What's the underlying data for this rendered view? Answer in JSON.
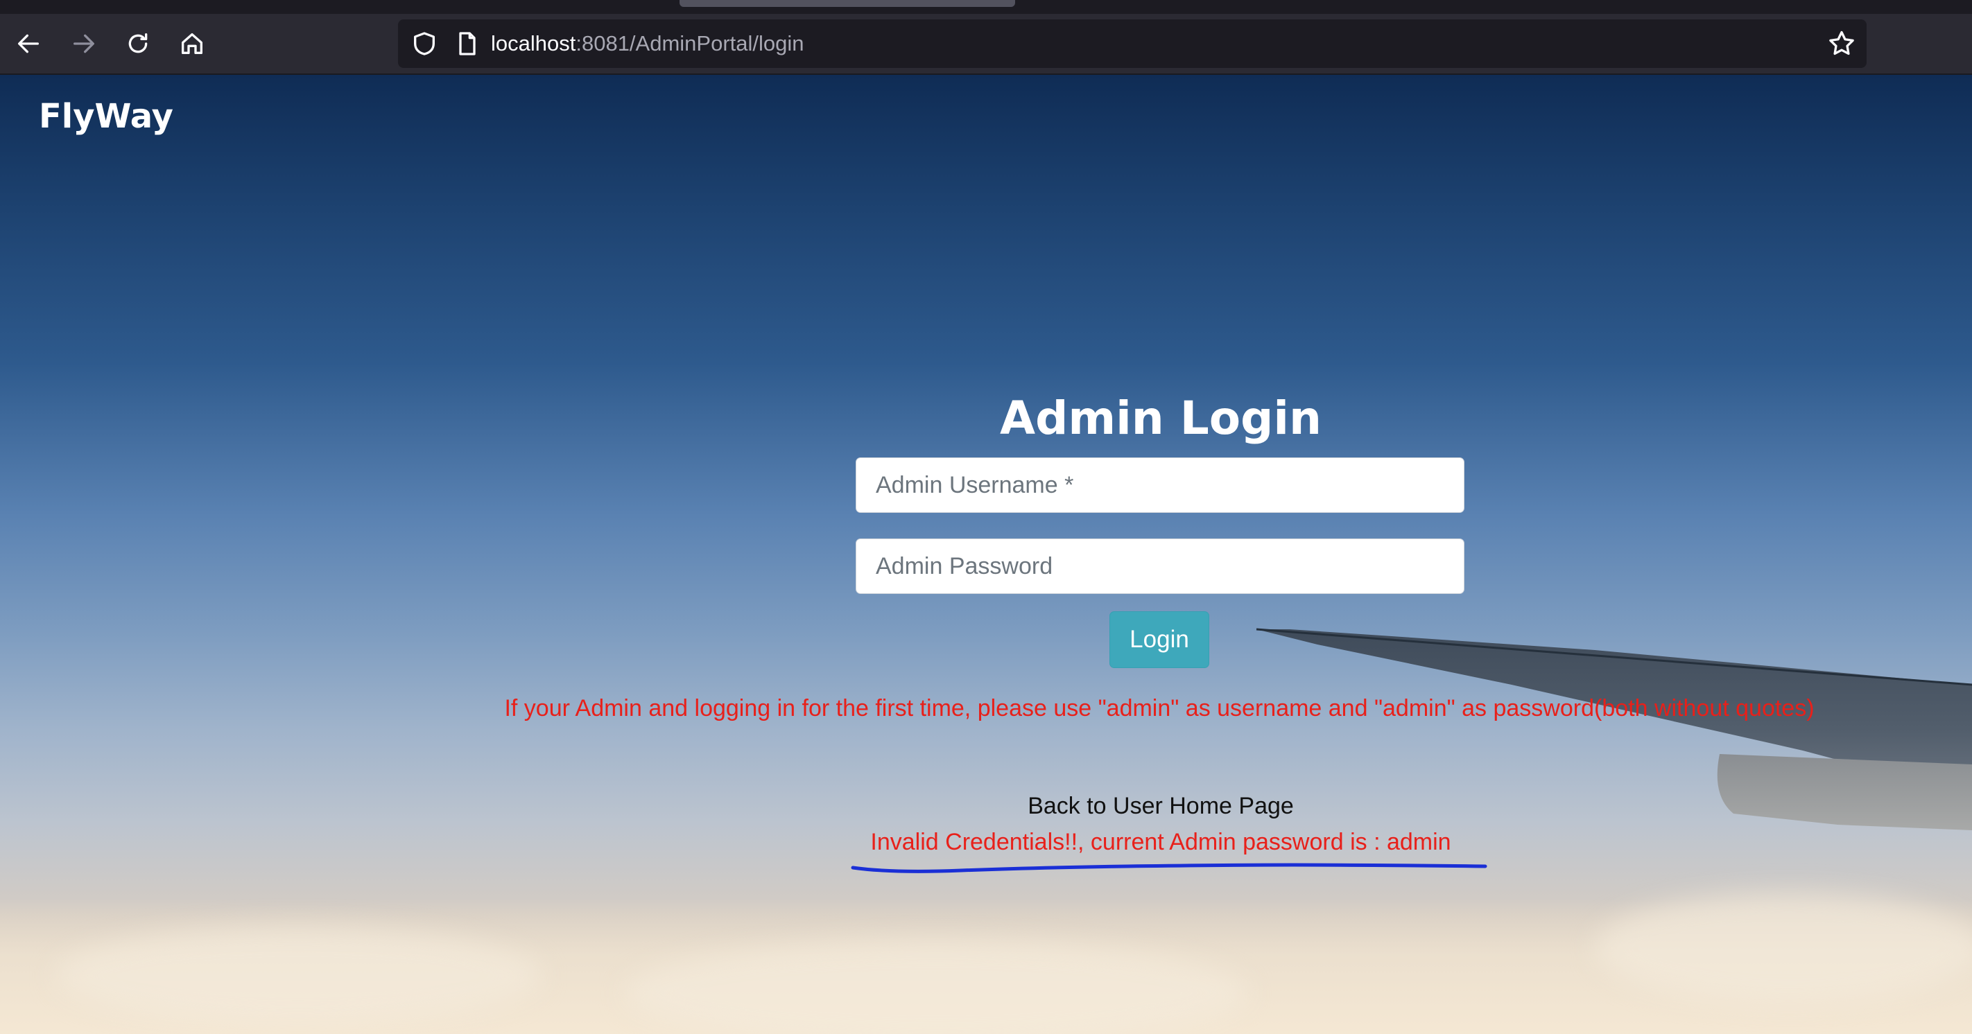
{
  "browser": {
    "url_host": "localhost",
    "url_path": ":8081/AdminPortal/login",
    "icons": {
      "back": "back-arrow-icon",
      "forward": "forward-arrow-icon",
      "reload": "reload-icon",
      "home": "home-icon",
      "shield": "shield-icon",
      "page": "page-icon",
      "bookmark": "star-icon"
    }
  },
  "page": {
    "brand": "FlyWay",
    "title": "Admin Login",
    "username": {
      "placeholder": "Admin Username *",
      "value": ""
    },
    "password": {
      "placeholder": "Admin Password",
      "value": ""
    },
    "login_button": "Login",
    "first_time_note": "If your Admin and logging in for the first time, please use \"admin\" as username and \"admin\" as password(both without quotes)",
    "back_link": "Back to User Home Page",
    "error_message": "Invalid Credentials!!, current Admin password is : admin"
  },
  "colors": {
    "button": "#3ea8bb",
    "error_text": "#e8201a",
    "annotation_ink": "#1a2fd6"
  }
}
